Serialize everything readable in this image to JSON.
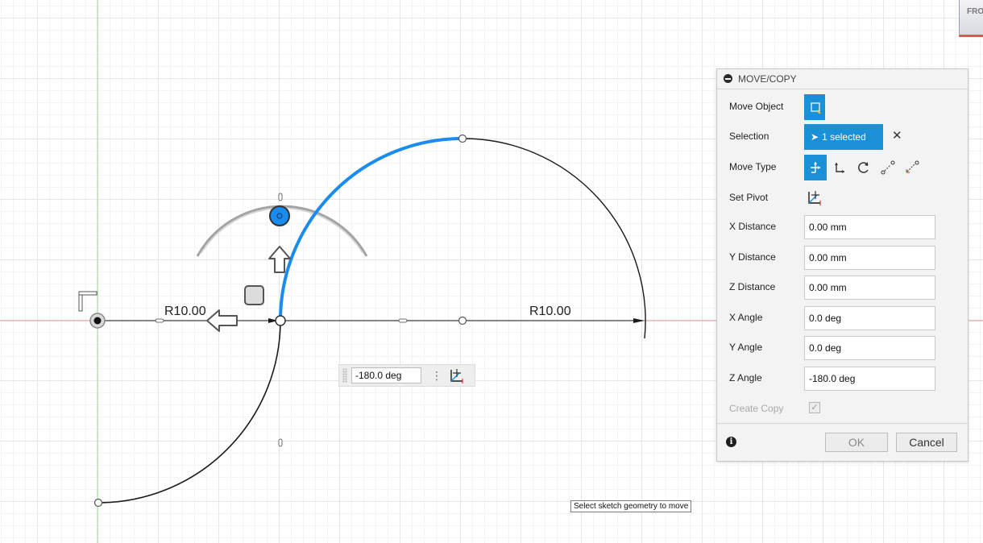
{
  "viewcube": {
    "label": "FRO"
  },
  "sketch": {
    "dimension_left": "R10.00",
    "dimension_right": "R10.00"
  },
  "inline_angle": {
    "value": "-180.0 deg"
  },
  "dialog": {
    "title": "MOVE/COPY",
    "rows": {
      "move_object": {
        "label": "Move Object"
      },
      "selection": {
        "label": "Selection",
        "button": "1 selected",
        "clear": "✕"
      },
      "move_type": {
        "label": "Move Type",
        "icons": [
          "free-move-icon",
          "translate-icon",
          "rotate-icon",
          "point-to-point-icon",
          "point-to-position-icon"
        ],
        "active": "free-move-icon"
      },
      "set_pivot": {
        "label": "Set Pivot"
      },
      "x_distance": {
        "label": "X Distance",
        "value": "0.00 mm"
      },
      "y_distance": {
        "label": "Y Distance",
        "value": "0.00 mm"
      },
      "z_distance": {
        "label": "Z Distance",
        "value": "0.00 mm"
      },
      "x_angle": {
        "label": "X Angle",
        "value": "0.0 deg"
      },
      "y_angle": {
        "label": "Y Angle",
        "value": "0.0 deg"
      },
      "z_angle": {
        "label": "Z Angle",
        "value": "-180.0 deg"
      },
      "create_copy": {
        "label": "Create Copy",
        "checked": true,
        "disabled": true
      }
    },
    "ok": "OK",
    "cancel": "Cancel"
  },
  "tooltip": "Select sketch geometry to move",
  "colors": {
    "accent": "#1a90d6",
    "x_axis": "#e99a9a",
    "y_axis": "#9fd99f",
    "selected_arc": "#1a8cf0"
  }
}
